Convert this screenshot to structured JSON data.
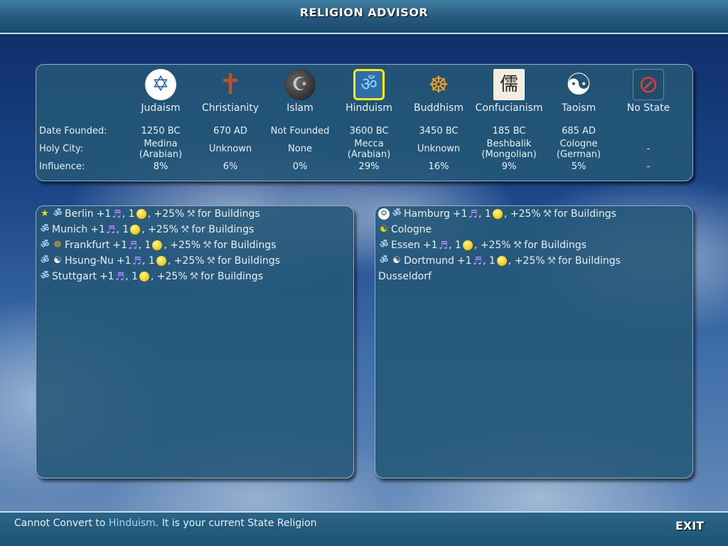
{
  "header": {
    "title": "RELIGION ADVISOR"
  },
  "labels": {
    "date_founded": "Date Founded:",
    "holy_city": "Holy City:",
    "influence": "Influence:"
  },
  "religions": [
    {
      "name": "Judaism",
      "icon": "star-of-david-icon",
      "date": "1250 BC",
      "holy1": "Medina",
      "holy2": "(Arabian)",
      "influence": "8%"
    },
    {
      "name": "Christianity",
      "icon": "cross-icon",
      "date": "670 AD",
      "holy1": "Unknown",
      "holy2": "",
      "influence": "6%"
    },
    {
      "name": "Islam",
      "icon": "crescent-icon",
      "date": "Not Founded",
      "holy1": "None",
      "holy2": "",
      "influence": "0%"
    },
    {
      "name": "Hinduism",
      "icon": "om-icon",
      "date": "3600 BC",
      "holy1": "Mecca",
      "holy2": "(Arabian)",
      "influence": "29%"
    },
    {
      "name": "Buddhism",
      "icon": "buddha-icon",
      "date": "3450 BC",
      "holy1": "Unknown",
      "holy2": "",
      "influence": "16%"
    },
    {
      "name": "Confucianism",
      "icon": "confucian-symbol-icon",
      "date": "185 BC",
      "holy1": "Beshbalik",
      "holy2": "(Mongolian)",
      "influence": "9%"
    },
    {
      "name": "Taoism",
      "icon": "yin-yang-icon",
      "date": "685 AD",
      "holy1": "Cologne",
      "holy2": "(German)",
      "influence": "5%"
    },
    {
      "name": "No State",
      "icon": "no-state-icon",
      "date": "",
      "holy1": "-",
      "holy2": "",
      "influence": "-"
    }
  ],
  "bonus": {
    "plus": "+1",
    "one": "1",
    "comma": ",",
    "pct": "+25%",
    "tail": "for Buildings"
  },
  "left_cities": [
    {
      "name": "Berlin"
    },
    {
      "name": "Munich"
    },
    {
      "name": "Frankfurt"
    },
    {
      "name": "Hsung-Nu"
    },
    {
      "name": "Stuttgart"
    }
  ],
  "right_cities": [
    {
      "name": "Hamburg"
    },
    {
      "name": "Cologne"
    },
    {
      "name": "Essen"
    },
    {
      "name": "Dortmund"
    },
    {
      "name": "Dusseldorf"
    }
  ],
  "status": {
    "prefix": "Cannot Convert to",
    "religion": "Hinduism",
    "suffix": ". It is your current State Religion"
  },
  "footer": {
    "exit_label": "EXIT"
  },
  "colors": {
    "selected_border": "#ffea00",
    "panel": "#245878",
    "highlight_text": "#9fd6ff"
  }
}
